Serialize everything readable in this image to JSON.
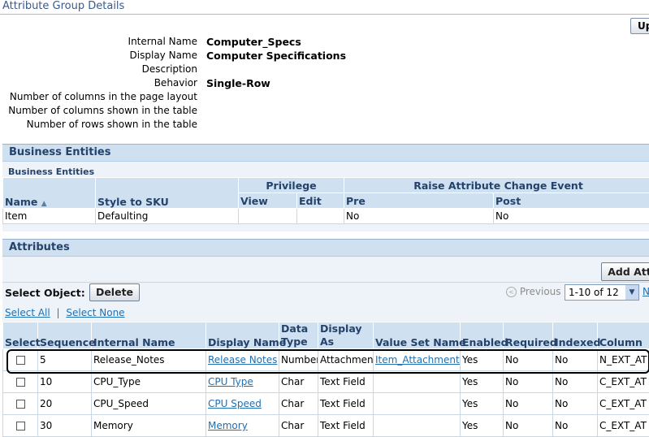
{
  "header": {
    "title": "Attribute Group Details",
    "update_button": "Up"
  },
  "details": [
    {
      "label": "Internal Name",
      "value": "Computer_Specs"
    },
    {
      "label": "Display Name",
      "value": "Computer Specifications"
    },
    {
      "label": "Description",
      "value": ""
    },
    {
      "label": "Behavior",
      "value": "Single-Row"
    },
    {
      "label": "Number of columns in the page layout",
      "value": ""
    },
    {
      "label": "Number of columns shown in the table",
      "value": ""
    },
    {
      "label": "Number of rows shown in the table",
      "value": ""
    }
  ],
  "business_entities": {
    "section_title": "Business Entities",
    "table_title": "Business Entities",
    "group_headers": {
      "privilege": "Privilege",
      "raise_event": "Raise Attribute Change Event"
    },
    "columns": {
      "name": "Name",
      "sort_icon": "sort-ascending-icon",
      "style_to_sku": "Style to SKU",
      "view": "View",
      "edit": "Edit",
      "pre": "Pre",
      "post": "Post"
    },
    "rows": [
      {
        "name": "Item",
        "style_to_sku": "Defaulting",
        "view": "",
        "edit": "",
        "pre": "No",
        "post": "No"
      }
    ]
  },
  "attributes": {
    "section_title": "Attributes",
    "add_button": "Add Att",
    "select_object_label": "Select Object:",
    "delete_button": "Delete",
    "previous_label": "Previous",
    "pager_value": "1-10 of 12",
    "next_label": "N",
    "select_all": "Select All",
    "select_none": "Select None",
    "columns": {
      "select": "Select",
      "sequence": "Sequence",
      "internal_name": "Internal Name",
      "display_name": "Display Name",
      "data_type_1": "Data",
      "data_type_2": "Type",
      "display_as_1": "Display",
      "display_as_2": "As",
      "value_set_name": "Value Set Name",
      "enabled": "Enabled",
      "required": "Required",
      "indexed": "Indexed",
      "column": "Column"
    },
    "rows": [
      {
        "sequence": "5",
        "internal_name": "Release_Notes",
        "display_name": "Release Notes",
        "data_type": "Number",
        "display_as": "Attachment",
        "value_set": "Item_Attachments",
        "enabled": "Yes",
        "required": "No",
        "indexed": "No",
        "column": "N_EXT_AT"
      },
      {
        "sequence": "10",
        "internal_name": "CPU_Type",
        "display_name": "CPU Type",
        "data_type": "Char",
        "display_as": "Text Field",
        "value_set": "",
        "enabled": "Yes",
        "required": "No",
        "indexed": "No",
        "column": "C_EXT_AT"
      },
      {
        "sequence": "20",
        "internal_name": "CPU_Speed",
        "display_name": "CPU Speed",
        "data_type": "Char",
        "display_as": "Text Field",
        "value_set": "",
        "enabled": "Yes",
        "required": "No",
        "indexed": "No",
        "column": "C_EXT_AT"
      },
      {
        "sequence": "30",
        "internal_name": "Memory",
        "display_name": "Memory",
        "data_type": "Char",
        "display_as": "Text Field",
        "value_set": "",
        "enabled": "Yes",
        "required": "No",
        "indexed": "No",
        "column": "C_EXT_AT"
      }
    ]
  }
}
